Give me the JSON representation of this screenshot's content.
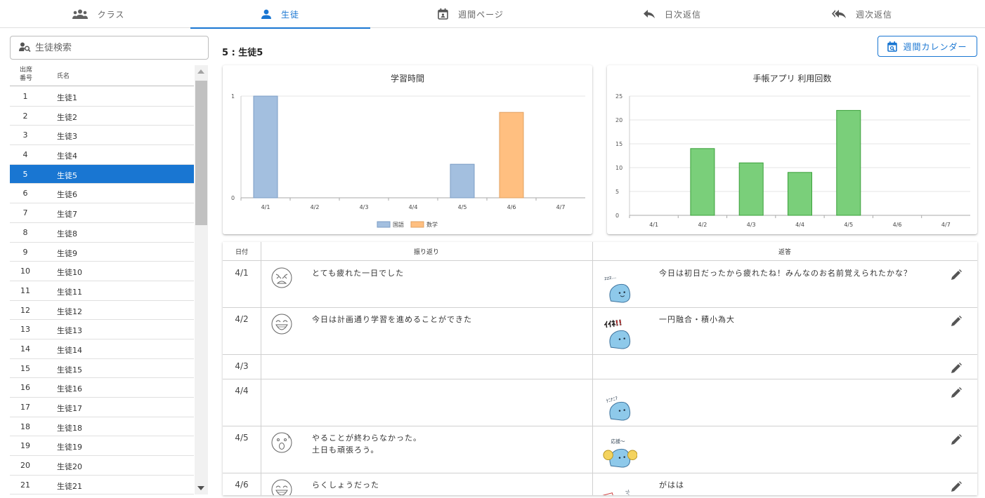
{
  "nav": {
    "tabs": [
      {
        "label": "クラス",
        "icon": "people-icon",
        "active": false
      },
      {
        "label": "生徒",
        "icon": "person-icon",
        "active": true
      },
      {
        "label": "週間ページ",
        "icon": "calendar-icon",
        "active": false
      },
      {
        "label": "日次返信",
        "icon": "reply-icon",
        "active": false
      },
      {
        "label": "週次返信",
        "icon": "reply-all-icon",
        "active": false
      }
    ]
  },
  "search": {
    "placeholder": "生徒検索"
  },
  "student_list": {
    "header_number": "出席\n番号",
    "header_number_l1": "出席",
    "header_number_l2": "番号",
    "header_name": "氏名",
    "selected": 5,
    "rows": [
      {
        "n": "1",
        "name": "生徒1"
      },
      {
        "n": "2",
        "name": "生徒2"
      },
      {
        "n": "3",
        "name": "生徒3"
      },
      {
        "n": "4",
        "name": "生徒4"
      },
      {
        "n": "5",
        "name": "生徒5"
      },
      {
        "n": "6",
        "name": "生徒6"
      },
      {
        "n": "7",
        "name": "生徒7"
      },
      {
        "n": "8",
        "name": "生徒8"
      },
      {
        "n": "9",
        "name": "生徒9"
      },
      {
        "n": "10",
        "name": "生徒10"
      },
      {
        "n": "11",
        "name": "生徒11"
      },
      {
        "n": "12",
        "name": "生徒12"
      },
      {
        "n": "13",
        "name": "生徒13"
      },
      {
        "n": "14",
        "name": "生徒14"
      },
      {
        "n": "15",
        "name": "生徒15"
      },
      {
        "n": "16",
        "name": "生徒16"
      },
      {
        "n": "17",
        "name": "生徒17"
      },
      {
        "n": "18",
        "name": "生徒18"
      },
      {
        "n": "19",
        "name": "生徒19"
      },
      {
        "n": "20",
        "name": "生徒20"
      },
      {
        "n": "21",
        "name": "生徒21"
      }
    ]
  },
  "main": {
    "student_title": "5 : 生徒5",
    "calendar_button": "週間カレンダー"
  },
  "chart_data": [
    {
      "type": "bar",
      "title": "学習時間",
      "categories": [
        "4/1",
        "4/2",
        "4/3",
        "4/4",
        "4/5",
        "4/6",
        "4/7"
      ],
      "ylim": [
        0,
        1
      ],
      "yticks": [
        "0",
        "1"
      ],
      "series": [
        {
          "name": "国語",
          "color": "#a3bfdf",
          "values": [
            1,
            0,
            0,
            0,
            0.33,
            0,
            0
          ]
        },
        {
          "name": "数学",
          "color": "#ffbf80",
          "values": [
            0,
            0,
            0,
            0,
            0,
            0.84,
            0
          ]
        }
      ],
      "legend": "bottom"
    },
    {
      "type": "bar",
      "title": "手帳アプリ 利用回数",
      "categories": [
        "4/1",
        "4/2",
        "4/3",
        "4/4",
        "4/5",
        "4/6",
        "4/7"
      ],
      "ylim": [
        0,
        25
      ],
      "yticks": [
        "0",
        "5",
        "10",
        "15",
        "20",
        "25"
      ],
      "series": [
        {
          "color": "#7acf7a",
          "values": [
            0,
            14,
            11,
            9,
            22,
            0,
            0
          ]
        }
      ]
    }
  ],
  "table": {
    "headers": {
      "date": "日付",
      "reflection": "振り返り",
      "reply": "返答"
    },
    "rows": [
      {
        "date": "4/1",
        "face": "tired-face-icon",
        "reflection": [
          "とても疲れた一日でした"
        ],
        "stamp": "sleepy-mascot-stamp",
        "reply": "今日は初日だったから疲れたね！みんなのお名前覚えられたかな？"
      },
      {
        "date": "4/2",
        "face": "happy-face-icon",
        "reflection": [
          "今日は計画通り学習を進めることができた"
        ],
        "stamp": "cheer-mascot-stamp",
        "reply": "一円融合・積小為大"
      },
      {
        "date": "4/3",
        "face": "",
        "reflection": [],
        "stamp": "",
        "reply": ""
      },
      {
        "date": "4/4",
        "face": "",
        "reflection": [],
        "stamp": "question-mascot-stamp",
        "reply": ""
      },
      {
        "date": "4/5",
        "face": "shocked-face-icon",
        "reflection": [
          "やることが終わらなかった。",
          "土日も頑張ろう。"
        ],
        "stamp": "pompom-mascot-stamp",
        "reply": ""
      },
      {
        "date": "4/6",
        "face": "happy-face-icon",
        "reflection": [
          "らくしょうだった"
        ],
        "stamp": "sign-mascot-stamp",
        "reply": "がはは"
      }
    ]
  }
}
